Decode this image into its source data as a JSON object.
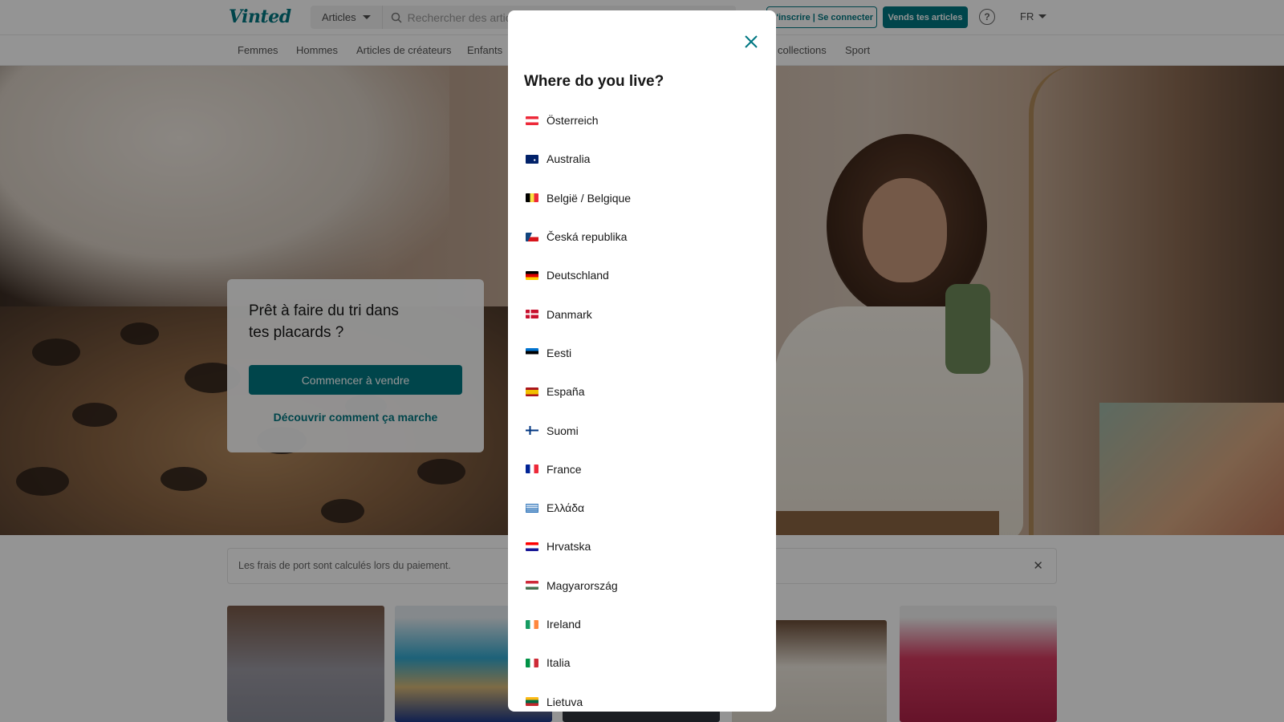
{
  "header": {
    "logo": "Vinted",
    "category_select": "Articles",
    "search_placeholder": "Rechercher des articles",
    "login_label": "S'inscrire | Se connecter",
    "sell_label": "Vends tes articles",
    "help_icon": "question-circle-icon",
    "language": "FR",
    "accent_color": "#007782"
  },
  "nav": {
    "items": [
      "Femmes",
      "Hommes",
      "Articles de créateurs",
      "Enfants",
      "collections",
      "Sport"
    ]
  },
  "hero": {
    "title": "Prêt à faire du tri dans tes placards ?",
    "primary_button": "Commencer à vendre",
    "link": "Découvrir comment ça marche"
  },
  "notice": {
    "text": "Les frais de port sont calculés lors du paiement.",
    "close_icon": "close-icon"
  },
  "modal": {
    "title": "Where do you live?",
    "close_icon": "close-icon",
    "countries": [
      {
        "name": "Österreich",
        "flag": "at"
      },
      {
        "name": "Australia",
        "flag": "au"
      },
      {
        "name": "België / Belgique",
        "flag": "be"
      },
      {
        "name": "Česká republika",
        "flag": "cz"
      },
      {
        "name": "Deutschland",
        "flag": "de"
      },
      {
        "name": "Danmark",
        "flag": "dk"
      },
      {
        "name": "Eesti",
        "flag": "ee"
      },
      {
        "name": "España",
        "flag": "es"
      },
      {
        "name": "Suomi",
        "flag": "fi"
      },
      {
        "name": "France",
        "flag": "fr"
      },
      {
        "name": "Ελλάδα",
        "flag": "gr"
      },
      {
        "name": "Hrvatska",
        "flag": "hr"
      },
      {
        "name": "Magyarország",
        "flag": "hu"
      },
      {
        "name": "Ireland",
        "flag": "ie"
      },
      {
        "name": "Italia",
        "flag": "it"
      },
      {
        "name": "Lietuva",
        "flag": "lt"
      }
    ]
  }
}
